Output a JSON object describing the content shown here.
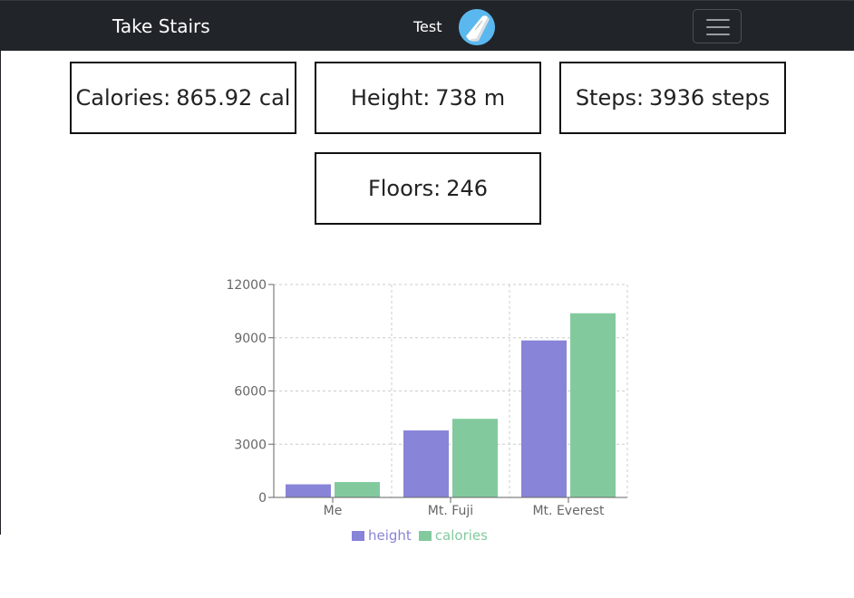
{
  "navbar": {
    "brand": "Take Stairs",
    "user_name": "Test",
    "avatar_icon": "sneaker-icon",
    "menu_icon": "hamburger-menu-icon",
    "background": "#212529"
  },
  "stats": {
    "calories": {
      "label": "Calories:",
      "value": "865.92 cal"
    },
    "height": {
      "label": "Height:",
      "value": "738 m"
    },
    "steps": {
      "label": "Steps:",
      "value": "3936 steps"
    },
    "floors": {
      "label": "Floors:",
      "value": "246"
    }
  },
  "chart_data": {
    "type": "bar",
    "categories": [
      "Me",
      "Mt. Fuji",
      "Mt. Everest"
    ],
    "series": [
      {
        "name": "height",
        "color": "#8884d8",
        "values": [
          738,
          3776,
          8848
        ]
      },
      {
        "name": "calories",
        "color": "#82ca9d",
        "values": [
          866,
          4430,
          10380
        ]
      }
    ],
    "yticks": [
      "0",
      "3000",
      "6000",
      "9000",
      "12000"
    ],
    "ylim": [
      0,
      12000
    ],
    "grid": true,
    "legend_position": "bottom"
  }
}
